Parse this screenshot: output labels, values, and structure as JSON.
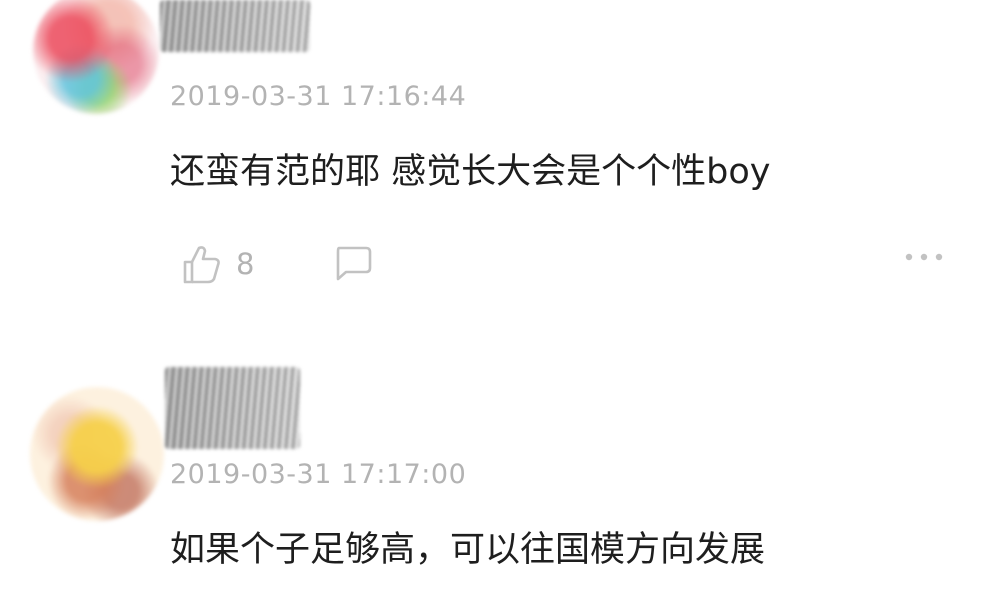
{
  "comments": [
    {
      "timestamp": "2019-03-31 17:16:44",
      "text": "还蛮有范的耶 感觉长大会是个个性boy",
      "likes": "8",
      "icons": {
        "like": "thumbs-up-icon",
        "reply": "comment-bubble-icon",
        "more": "more-dots-icon"
      }
    },
    {
      "timestamp": "2019-03-31 17:17:00",
      "text": "如果个子足够高，可以往国模方向发展"
    }
  ],
  "colors": {
    "timestamp": "#b3b3b3",
    "text": "#1e1e1e",
    "icon": "#c2c2c2"
  }
}
